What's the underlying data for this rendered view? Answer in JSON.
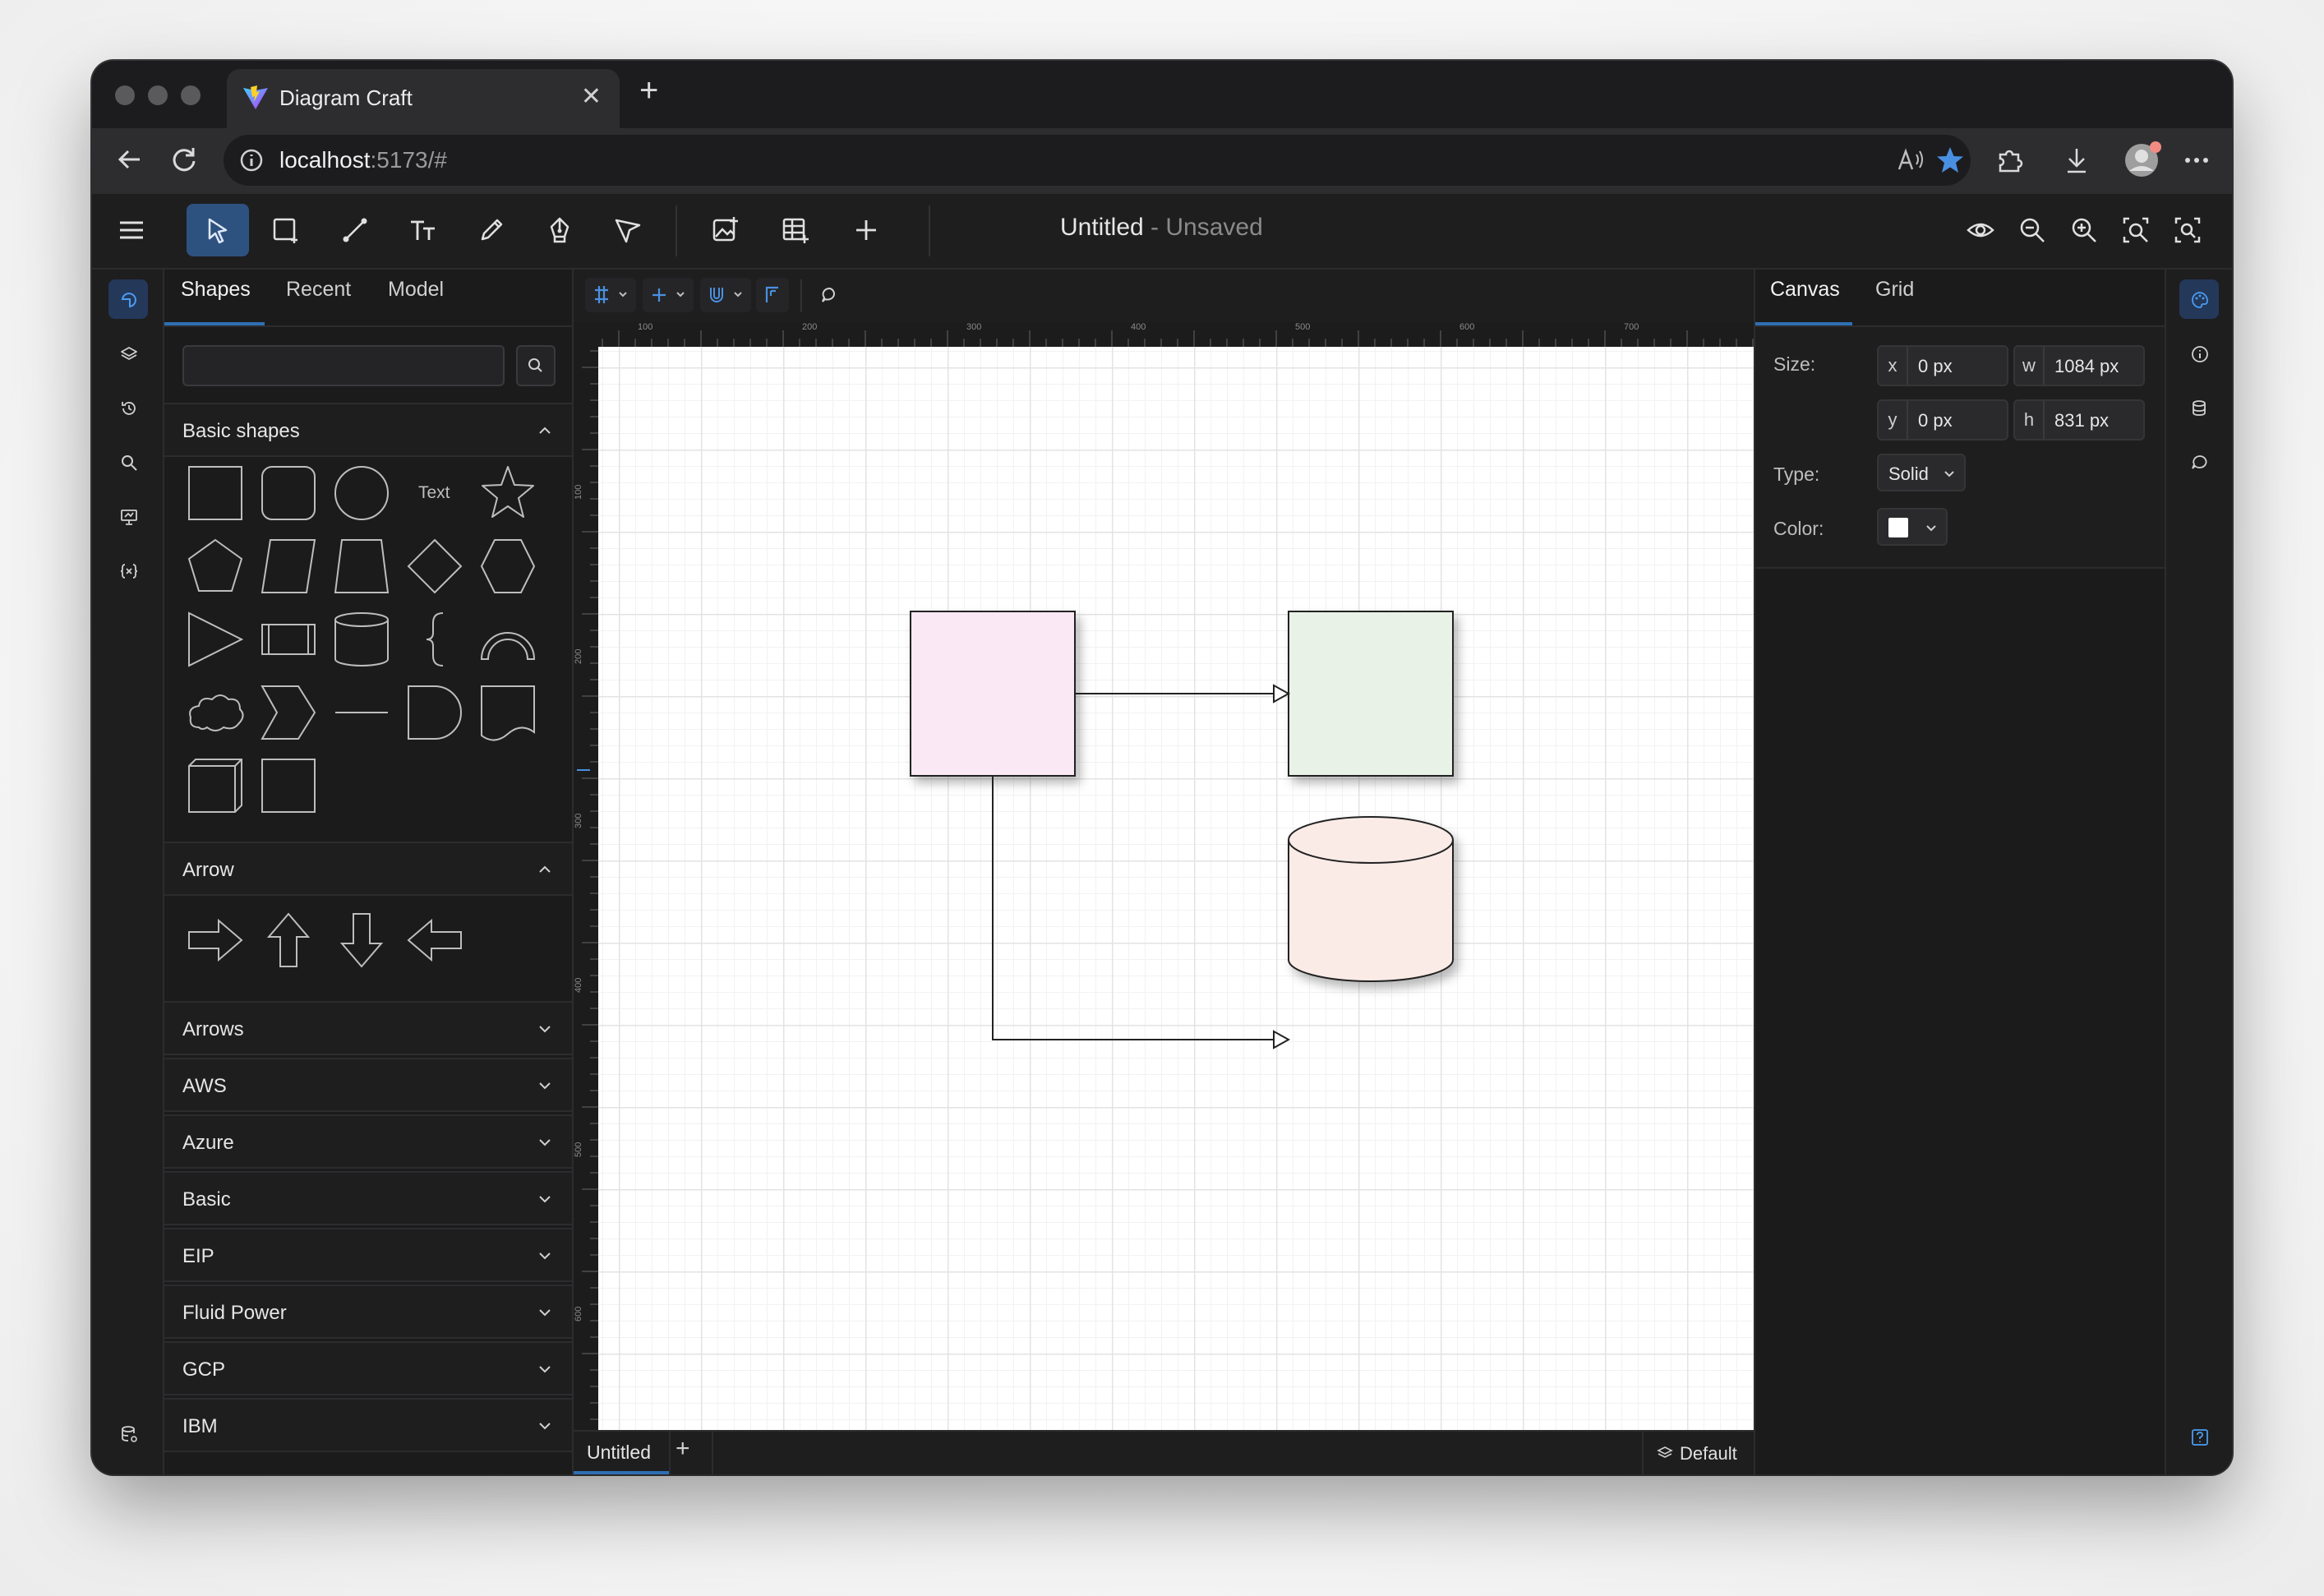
{
  "browser": {
    "tab_title": "Diagram Craft",
    "url_host": "localhost",
    "url_path": ":5173/#"
  },
  "toolbar": {
    "doc_title": "Untitled",
    "doc_status": " - Unsaved"
  },
  "shapes_panel": {
    "tabs": [
      "Shapes",
      "Recent",
      "Model"
    ],
    "search_placeholder": "",
    "basic_shapes_title": "Basic shapes",
    "text_shape_label": "Text",
    "arrow_title": "Arrow",
    "libraries": [
      "Arrows",
      "AWS",
      "Azure",
      "Basic",
      "EIP",
      "Fluid Power",
      "GCP",
      "IBM"
    ]
  },
  "canvas": {
    "ruler_top_labels": [
      "100",
      "200",
      "300",
      "400",
      "500",
      "600",
      "700"
    ],
    "ruler_left_labels": [
      "100",
      "200",
      "300",
      "400",
      "500",
      "600"
    ],
    "page_tab": "Untitled",
    "layer": "Default",
    "colors": {
      "box1_fill": "#fae8f4",
      "box2_fill": "#e9f2e7",
      "cylinder_fill": "#fbebe6"
    }
  },
  "right_panel": {
    "tabs": [
      "Canvas",
      "Grid"
    ],
    "size_label": "Size:",
    "x_label": "x",
    "x_value": "0 px",
    "y_label": "y",
    "y_value": "0 px",
    "w_label": "w",
    "w_value": "1084 px",
    "h_label": "h",
    "h_value": "831 px",
    "type_label": "Type:",
    "type_value": "Solid",
    "color_label": "Color:",
    "color_value": "#ffffff"
  }
}
